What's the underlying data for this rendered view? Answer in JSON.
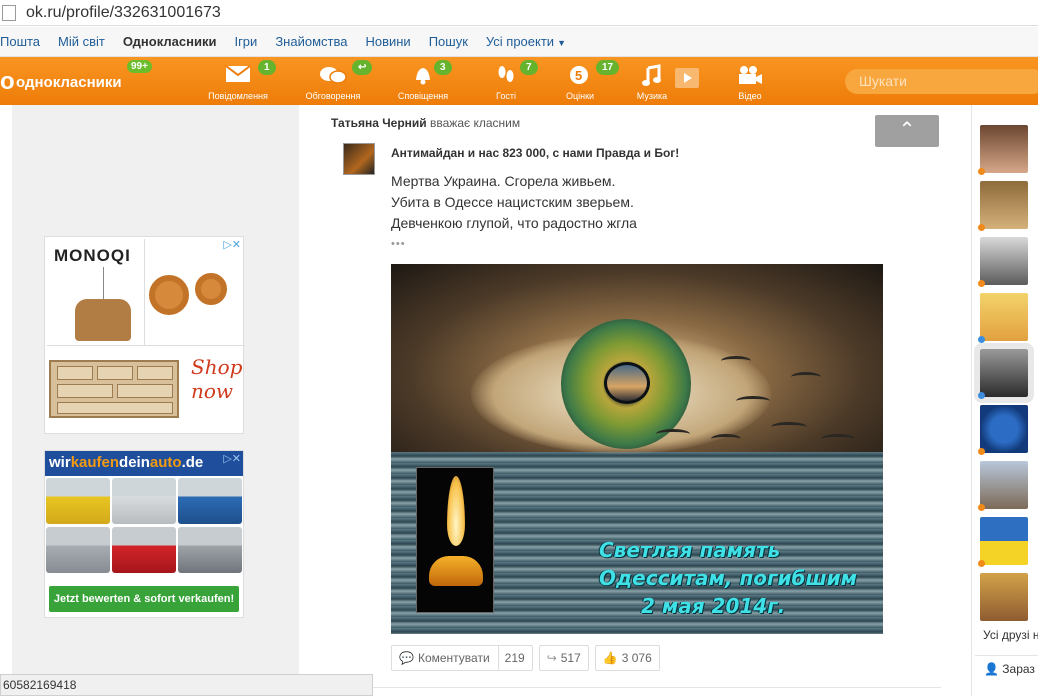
{
  "browser": {
    "url": "ok.ru/profile/332631001673"
  },
  "portal_links": [
    {
      "label": "Пошта"
    },
    {
      "label": "Мій світ"
    },
    {
      "label": "Однокласники"
    },
    {
      "label": "Ігри"
    },
    {
      "label": "Знайомства"
    },
    {
      "label": "Новини"
    },
    {
      "label": "Пошук"
    },
    {
      "label": "Усі проекти"
    }
  ],
  "toolbar": {
    "logo_text": "однокласники",
    "logo_badge": "99+",
    "items": [
      {
        "label": "Повідомлення",
        "badge": "1",
        "icon": "envelope-icon"
      },
      {
        "label": "Обговорення",
        "badge": "↩",
        "icon": "chat-bubbles-icon"
      },
      {
        "label": "Сповіщення",
        "badge": "3",
        "icon": "bell-icon"
      },
      {
        "label": "Гості",
        "badge": "7",
        "icon": "footprints-icon"
      },
      {
        "label": "Оцінки",
        "badge": "17",
        "icon": "rating-five-icon"
      },
      {
        "label": "Музика",
        "badge": "",
        "icon": "music-note-icon"
      },
      {
        "label": "Відео",
        "badge": "",
        "icon": "video-camera-icon"
      }
    ],
    "search_placeholder": "Шукати"
  },
  "ads": {
    "ad1": {
      "brand": "MONOQI",
      "cta": "Shop now",
      "close": "▷✕"
    },
    "ad2": {
      "brand_a": "wir",
      "brand_b": "kaufen",
      "brand_c": "dein",
      "brand_d": "auto",
      "brand_e": ".de",
      "cta": "Jetzt bewerten & sofort verkaufen!",
      "close": "▷✕"
    }
  },
  "post": {
    "actor_name": "Татьяна Черний",
    "actor_action": "вважає класним",
    "group_title": "Антимайдан и нас 823 000, с нами Правда и Бог!",
    "lines": [
      "Мертва Украина. Сгорела живьем.",
      "Убита в Одессе нацистским зверьем.",
      "Девченкою глупой, что радостно жгла"
    ],
    "more": "•••",
    "image_caption": [
      "Светлая память",
      "Одесситам, погибшим",
      "2 мая 2014г."
    ],
    "comment_label": "Коментувати",
    "comment_count": "219",
    "share_count": "517",
    "like_count": "3 076"
  },
  "friends": {
    "all_label": "Усі друзі н",
    "now_label": "Зараз"
  },
  "statusbar": {
    "text": "60582169418"
  },
  "colors": {
    "brand_orange": "#ee7c08",
    "badge_green": "#66b32e",
    "link_blue": "#1f5d98"
  }
}
